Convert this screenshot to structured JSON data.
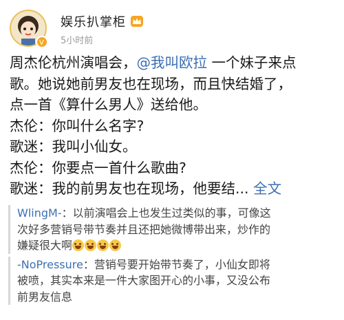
{
  "post": {
    "username": "娱乐扒掌柜",
    "time": "5小时前",
    "icons": [
      "avatar-cartoon-icon",
      "verified-badge-icon",
      "crown-icon"
    ],
    "colors": {
      "link": "#3d6fb3",
      "verified": "#f5a623"
    },
    "text": {
      "l1_pre": "周杰伦杭州演唱会，",
      "mention": "@我叫欧拉",
      "l1_post": " 一个妹子来点",
      "l2": "歌。她说她前男友也在现场，而且快结婚了，",
      "l3": "点一首《算什么男人》送给他。",
      "l4": "杰伦：你叫什么名字?",
      "l5": "歌迷：我叫小仙女。",
      "l6": "杰伦：你要点一首什么歌曲?",
      "l7": "歌迷：我的前男友也在现场，他要结...",
      "full_text": "全文"
    }
  },
  "comments": [
    {
      "user": "WlingM-",
      "l1": "：以前演唱会上也发生过类似的事，可像这",
      "l2": "次好多营销号带节奏并且还把她微博带出来，炒作的",
      "l3": "嫌疑很大啊",
      "emoji_count": 4
    },
    {
      "user": "-NoPressure",
      "l1": "：营销号要开始带节奏了，小仙女即将",
      "l2": "被喷，其实本来是一件大家图开心的小事，又没公布",
      "l3": "前男友信息"
    }
  ]
}
